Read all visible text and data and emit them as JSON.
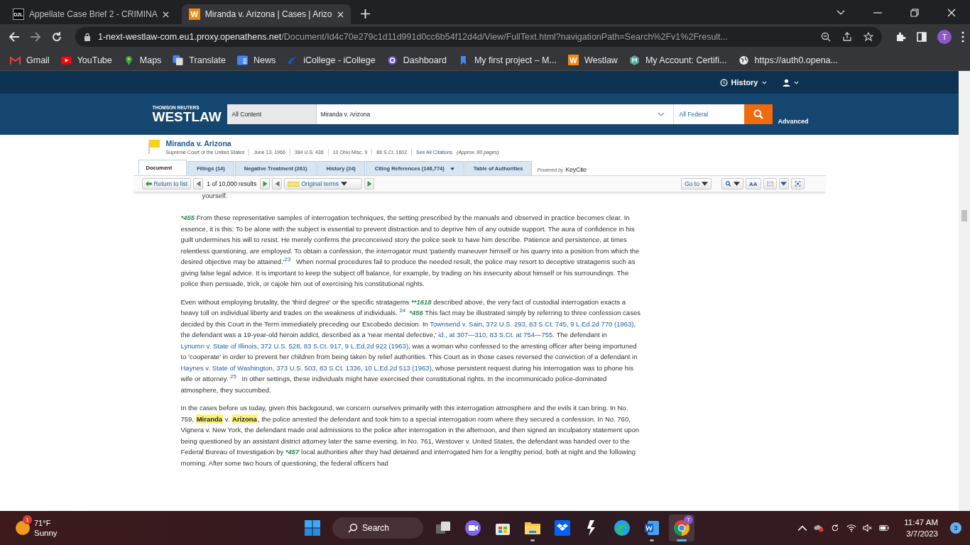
{
  "browser": {
    "tabs": [
      {
        "favicon": {
          "kind": "dark",
          "text": "D2L"
        },
        "title": "Appellate Case Brief 2 - CRIMINA",
        "selected": false
      },
      {
        "favicon": {
          "kind": "orange",
          "text": "W"
        },
        "title": "Miranda v. Arizona | Cases | Arizo",
        "selected": true
      }
    ],
    "url": {
      "host": "1-next-westlaw-com.eu1.proxy.openathens.net",
      "path": "/Document/Id4c70e279c1d11d991d0cc6b54f12d4d/View/FullText.html?navigationPath=Search%2Fv1%2Fresult..."
    },
    "profile_initial": "T",
    "bookmarks": [
      {
        "kind": "mail",
        "label": "Gmail"
      },
      {
        "kind": "play",
        "label": "YouTube"
      },
      {
        "kind": "pin",
        "label": "Maps"
      },
      {
        "kind": "translate",
        "label": "Translate"
      },
      {
        "kind": "news",
        "label": "News"
      },
      {
        "kind": "swoosh",
        "label": "iCollege - iCollege"
      },
      {
        "kind": "ring",
        "label": "Dashboard"
      },
      {
        "kind": "ribbon",
        "label": "My first project – M..."
      },
      {
        "kind": "letter",
        "letter": "W",
        "label": "Westlaw"
      },
      {
        "kind": "hexagon",
        "label": "My Account: Certifi..."
      },
      {
        "kind": "globe",
        "label": "https://auth0.opena..."
      }
    ]
  },
  "westlaw": {
    "history": "History",
    "brand_top": "THOMSON REUTERS",
    "brand": "WESTLAW",
    "scope": "All Content",
    "query": "Miranda v. Arizona",
    "jurisdiction": "All Federal",
    "advanced": "Advanced",
    "title": "Miranda v. Arizona",
    "meta": [
      "Supreme Court of the United States",
      "June 13, 1966",
      "384 U.S. 436",
      "10 Ohio Misc. 9",
      "86 S.Ct. 1602"
    ],
    "see_all": "See All Citations",
    "pages": "(Approx. 80 pages)",
    "tabs": [
      {
        "label": "Document",
        "selected": true,
        "dropdown": false
      },
      {
        "label": "Filings (14)",
        "selected": false,
        "dropdown": false
      },
      {
        "label": "Negative Treatment (261)",
        "selected": false,
        "dropdown": false
      },
      {
        "label": "History (24)",
        "selected": false,
        "dropdown": false
      },
      {
        "label": "Citing References (146,774)",
        "selected": false,
        "dropdown": true
      },
      {
        "label": "Table of Authorities",
        "selected": false,
        "dropdown": false
      }
    ],
    "powered_by": "Powered by",
    "keycite": "KeyCite",
    "toolbar": {
      "return": "Return to list",
      "results": "1 of 10,000 results",
      "terms": "Original terms",
      "goto": "Go to",
      "text_size": "AA"
    }
  },
  "document": {
    "partial_line": "yourself.",
    "paragraphs": [
      {
        "segments": [
          {
            "kind": "star",
            "text": "*455"
          },
          {
            "kind": "text",
            "text": " From these representative samples of interrogation techniques, the setting prescribed by the manuals and observed in practice becomes clear. In essence, it is this: To be alone with the subject is essential to prevent distraction and to deprive him of any outside support. The aura of confidence in his guilt undermines his will to resist. He merely confirms the preconceived story the police seek to have him describe. Patience and persistence, at times relentless questioning, are employed. To obtain a confession, the interrogator must 'patiently maneuver himself or his quarry into a position from which the desired objective may be attained.'"
          },
          {
            "kind": "footnote",
            "text": "23"
          },
          {
            "kind": "text",
            "text": " When normal procedures fail to produce the needed result, the police may resort to deceptive stratagems such as giving false legal advice. It is important to keep the subject off balance, for example, by trading on his insecurity about himself or his surroundings. The police then persuade, trick, or cajole him out of exercising his constitutional rights."
          }
        ]
      },
      {
        "segments": [
          {
            "kind": "text",
            "text": "Even without employing brutality, the 'third degree' or the specific stratagems "
          },
          {
            "kind": "star",
            "text": "**1618"
          },
          {
            "kind": "text",
            "text": " described above, the very fact of custodial interrogation exacts a heavy toll on individual liberty and trades on the weakness of individuals. "
          },
          {
            "kind": "footnote",
            "text": "24"
          },
          {
            "kind": "star",
            "text": "*456"
          },
          {
            "kind": "text",
            "text": " This fact may be illustrated simply by referring to three confession cases decided by this Court in the Term immediately preceding our Escobedo decision. In "
          },
          {
            "kind": "link",
            "text": "Townsend v. Sain, 372 U.S. 293, 83 S.Ct. 745, 9 L.Ed.2d 770 (1963)"
          },
          {
            "kind": "text",
            "text": ", the defendant was a 19-year-old heroin addict, described as a 'near mental defective,' "
          },
          {
            "kind": "link",
            "text": "id., at 307—310, 83 S.Ct. at 754—755"
          },
          {
            "kind": "text",
            "text": ". The defendant in "
          },
          {
            "kind": "link",
            "text": "Lynumn v. State of Illinois, 372 U.S. 528, 83 S.Ct. 917, 9 L.Ed.2d 922 (1963)"
          },
          {
            "kind": "text",
            "text": ", was a woman who confessed to the arresting officer after being importuned to 'cooperate' in order to prevent her children from being taken by relief authorities. This Court as in those cases reversed the conviction of a defendant in "
          },
          {
            "kind": "link",
            "text": "Haynes v. State of Washington, 373 U.S. 503, 83 S.Ct. 1336, 10 L.Ed.2d 513 (1963)"
          },
          {
            "kind": "text",
            "text": ", whose persistent request during his interrogation was to phone his wife or attorney. "
          },
          {
            "kind": "footnote",
            "text": "25"
          },
          {
            "kind": "text",
            "text": " In other settings, these individuals might have exercised their constitutional rights. In the incommunicado police-dominated atmosphere, they succumbed."
          }
        ]
      },
      {
        "segments": [
          {
            "kind": "text",
            "text": "In the cases before us today, given this backgound, we concern ourselves primarily with this interrogation atmosphere and the evils it can bring. In No. 759, "
          },
          {
            "kind": "highlight",
            "text": "Miranda"
          },
          {
            "kind": "text",
            "text": " v. "
          },
          {
            "kind": "highlight",
            "text": "Arizona"
          },
          {
            "kind": "text",
            "text": ", the police arrested the defendant and took him to a special interrogation room where they secured a confession. In No. 760, Vignera v. New York, the defendant made oral admissions to the police after interrogation in the afternoon, and then signed an inculpatory statement upon being questioned by an assistant district attorney later the same evening. In No. 761, Westover v. United States, the defendant was handed over to the Federal Bureau of Investigation by "
          },
          {
            "kind": "star",
            "text": "*457"
          },
          {
            "kind": "text",
            "text": " local authorities after they had detained and interrogated him for a lengthy period, both at night and the following morning. After some two hours of questioning, the federal officers had"
          }
        ]
      }
    ]
  },
  "taskbar": {
    "weather": {
      "badge": "1",
      "temp": "71°F",
      "condition": "Sunny"
    },
    "apps": [
      {
        "kind": "start",
        "selected": false,
        "running": false
      },
      {
        "kind": "search",
        "label": "Search"
      },
      {
        "kind": "taskview",
        "selected": false,
        "running": false
      },
      {
        "kind": "video",
        "selected": false,
        "running": false
      },
      {
        "kind": "store",
        "selected": false,
        "running": false
      },
      {
        "kind": "folder",
        "selected": false,
        "running": true
      },
      {
        "kind": "box",
        "selected": false,
        "running": false
      },
      {
        "kind": "bolt",
        "selected": false,
        "running": false
      },
      {
        "kind": "edge",
        "selected": false,
        "running": false
      },
      {
        "kind": "word",
        "selected": false,
        "running": true
      },
      {
        "kind": "chrome",
        "badge": "T",
        "selected": true,
        "running": true
      }
    ],
    "time": "11:47 AM",
    "date": "3/7/2023",
    "notifications": "3"
  }
}
